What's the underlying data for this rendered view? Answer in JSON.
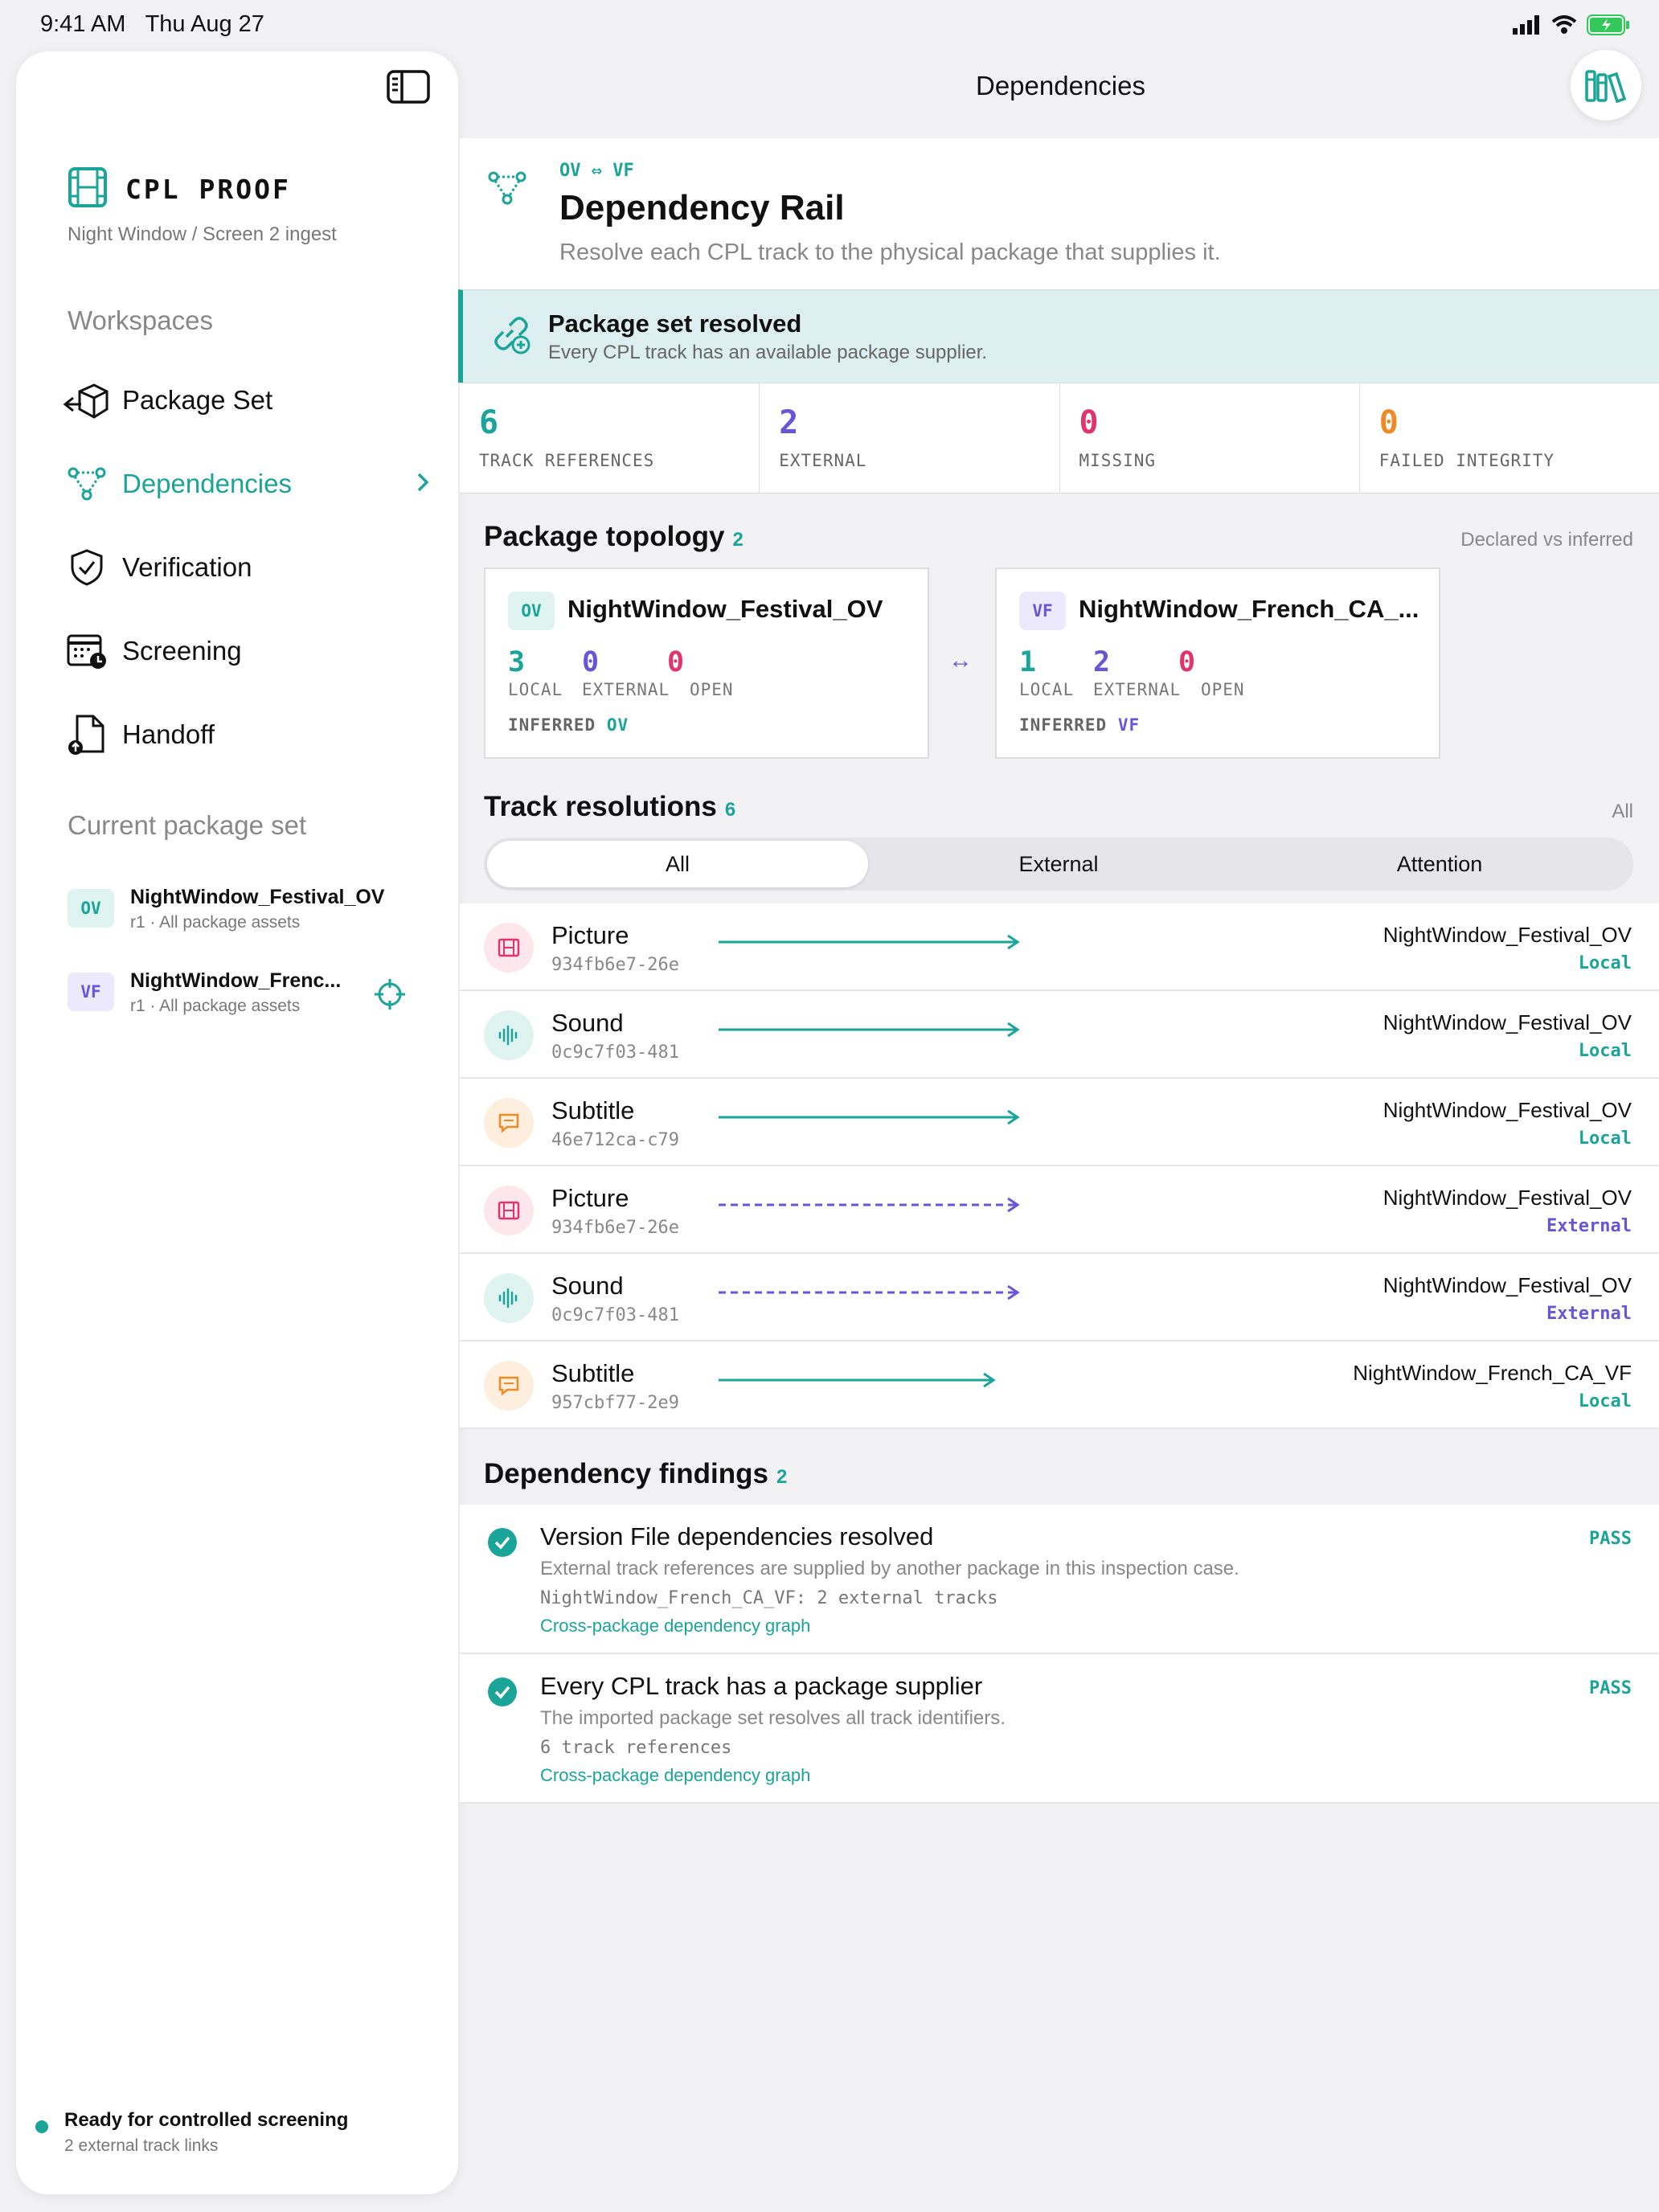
{
  "status_bar": {
    "time": "9:41 AM",
    "date": "Thu Aug 27"
  },
  "sidebar": {
    "brand_title": "CPL PROOF",
    "brand_subtitle": "Night Window / Screen 2 ingest",
    "workspaces_heading": "Workspaces",
    "nav": [
      {
        "label": "Package Set",
        "icon": "package-icon"
      },
      {
        "label": "Dependencies",
        "icon": "dependency-icon",
        "active": true
      },
      {
        "label": "Verification",
        "icon": "shield-check-icon"
      },
      {
        "label": "Screening",
        "icon": "calendar-clock-icon"
      },
      {
        "label": "Handoff",
        "icon": "document-upload-icon"
      }
    ],
    "current_heading": "Current package set",
    "packages": [
      {
        "badge": "OV",
        "name": "NightWindow_Festival_OV",
        "sub": "r1 · All package assets"
      },
      {
        "badge": "VF",
        "name": "NightWindow_Frenc...",
        "sub": "r1 · All package assets"
      }
    ],
    "ready_title": "Ready for controlled screening",
    "ready_sub": "2 external track links"
  },
  "main": {
    "title": "Dependencies",
    "header": {
      "tag": "OV ⇔ VF",
      "title": "Dependency Rail",
      "subtitle": "Resolve each CPL track to the physical package that supplies it."
    },
    "banner": {
      "title": "Package set resolved",
      "subtitle": "Every CPL track has an available package supplier."
    },
    "stats": [
      {
        "value": "6",
        "label": "TRACK REFERENCES",
        "color": "#1aa49a"
      },
      {
        "value": "2",
        "label": "EXTERNAL",
        "color": "#6a55d6"
      },
      {
        "value": "0",
        "label": "MISSING",
        "color": "#e0346b"
      },
      {
        "value": "0",
        "label": "FAILED INTEGRITY",
        "color": "#f08a24"
      }
    ],
    "topology": {
      "title": "Package topology",
      "count": "2",
      "aside": "Declared vs inferred",
      "arrow": "↔",
      "cards": [
        {
          "badge": "OV",
          "name": "NightWindow_Festival_OV",
          "local": "3",
          "external": "0",
          "open": "0",
          "local_label": "LOCAL",
          "external_label": "EXTERNAL",
          "open_label": "OPEN",
          "inferred_label": "INFERRED",
          "inferred_value": "OV"
        },
        {
          "badge": "VF",
          "name": "NightWindow_French_CA_...",
          "local": "1",
          "external": "2",
          "open": "0",
          "local_label": "LOCAL",
          "external_label": "EXTERNAL",
          "open_label": "OPEN",
          "inferred_label": "INFERRED",
          "inferred_value": "VF"
        }
      ]
    },
    "tracks": {
      "title": "Track resolutions",
      "count": "6",
      "aside": "All",
      "segments": [
        "All",
        "External",
        "Attention"
      ],
      "rows": [
        {
          "type": "Picture",
          "id": "934fb6e7-26e",
          "pkg": "NightWindow_Festival_OV",
          "kind": "Local"
        },
        {
          "type": "Sound",
          "id": "0c9c7f03-481",
          "pkg": "NightWindow_Festival_OV",
          "kind": "Local"
        },
        {
          "type": "Subtitle",
          "id": "46e712ca-c79",
          "pkg": "NightWindow_Festival_OV",
          "kind": "Local"
        },
        {
          "type": "Picture",
          "id": "934fb6e7-26e",
          "pkg": "NightWindow_Festival_OV",
          "kind": "External"
        },
        {
          "type": "Sound",
          "id": "0c9c7f03-481",
          "pkg": "NightWindow_Festival_OV",
          "kind": "External"
        },
        {
          "type": "Subtitle",
          "id": "957cbf77-2e9",
          "pkg": "NightWindow_French_CA_VF",
          "kind": "Local"
        }
      ]
    },
    "findings": {
      "title": "Dependency findings",
      "count": "2",
      "items": [
        {
          "title": "Version File dependencies resolved",
          "desc": "External track references are supplied by another package in this inspection case.",
          "meta": "NightWindow_French_CA_VF: 2 external tracks",
          "link": "Cross-package dependency graph",
          "status": "PASS"
        },
        {
          "title": "Every CPL track has a package supplier",
          "desc": "The imported package set resolves all track identifiers.",
          "meta": "6 track references",
          "link": "Cross-package dependency graph",
          "status": "PASS"
        }
      ]
    }
  },
  "colors": {
    "accent": "#1aa49a",
    "external": "#6a55d6",
    "missing": "#e0346b",
    "failed": "#f08a24"
  }
}
